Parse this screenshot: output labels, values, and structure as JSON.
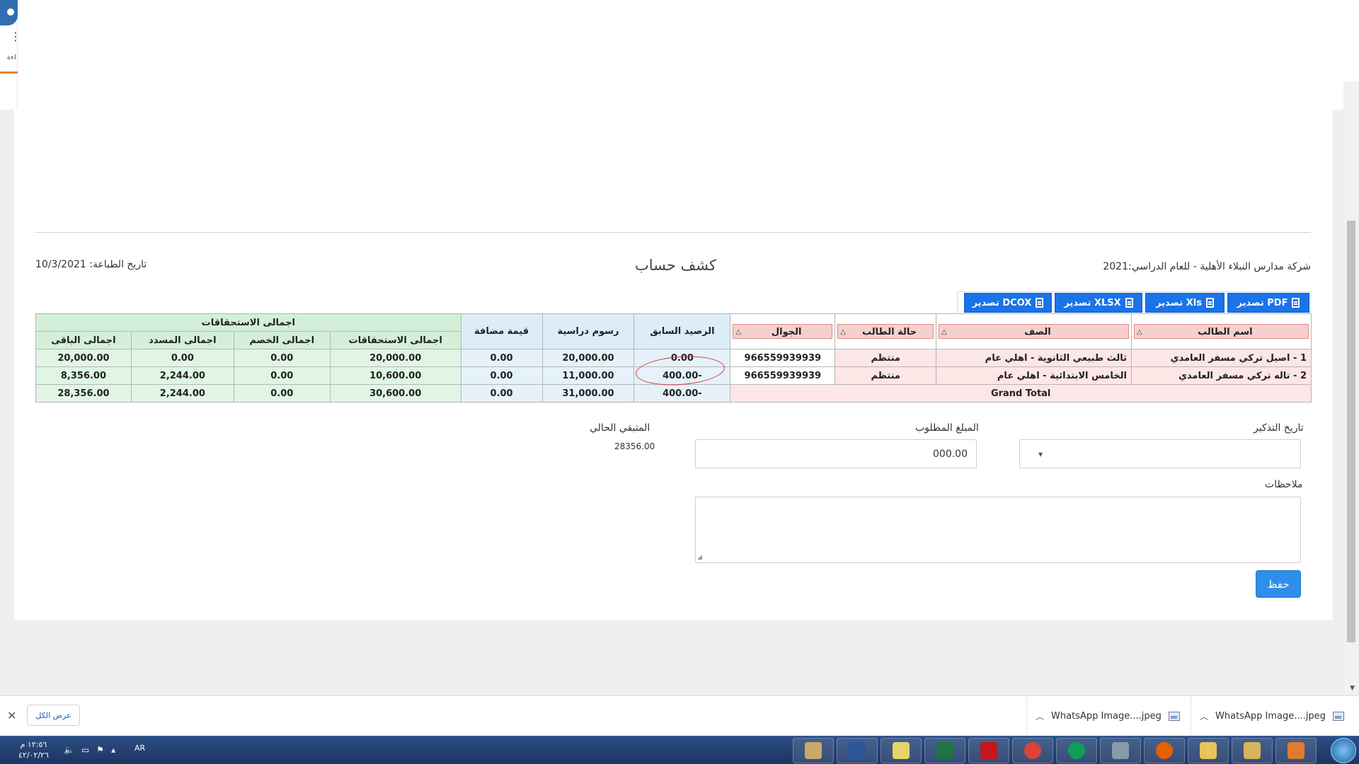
{
  "browser": {
    "menu_glyph": "⋮",
    "side_label": "اءة"
  },
  "report": {
    "company": "شركة مدارس النبلاء الأهلية  - للعام الدراسي:2021",
    "title": "كشف حساب",
    "print_date": "تاريخ الطباعة: 10/3/2021"
  },
  "export_buttons": [
    {
      "label": "تصدير PDF"
    },
    {
      "label": "تصدير Xls"
    },
    {
      "label": "تصدير XLSX"
    },
    {
      "label": "تصدير DCOX"
    }
  ],
  "table": {
    "headers": {
      "student_name": "اسم الطالب",
      "grade": "الصف",
      "status": "حالة الطالب",
      "mobile": "الجوال",
      "prev_balance": "الرصيد السابق",
      "tuition": "رسوم دراسية",
      "added_value": "قيمة مضافة",
      "dues_group": "اجمالى الاستحقاقات",
      "total_dues": "اجمالى الاستحقاقات",
      "total_discount": "اجمالى الخصم",
      "total_paid": "اجمالى المسدد",
      "total_remaining": "اجمالى الباقى",
      "sort_glyph": "△"
    },
    "rows": [
      {
        "name": "1 - اصيل تركي مسفر العامدي",
        "grade": "ثالث طبيعي الثانوية - اهلي عام",
        "status": "منتظم",
        "mobile": "966559939939",
        "prev_balance": "0.00",
        "tuition": "20,000.00",
        "added_value": "0.00",
        "total_dues": "20,000.00",
        "total_discount": "0.00",
        "total_paid": "0.00",
        "total_remaining": "20,000.00"
      },
      {
        "name": "2 - تاله تركي مسفر العامدي",
        "grade": "الخامس الابتدائية - اهلي عام",
        "status": "منتظم",
        "mobile": "966559939939",
        "prev_balance": "-400.00",
        "tuition": "11,000.00",
        "added_value": "0.00",
        "total_dues": "10,600.00",
        "total_discount": "0.00",
        "total_paid": "2,244.00",
        "total_remaining": "8,356.00"
      }
    ],
    "grand_total": {
      "label": "Grand Total",
      "prev_balance": "-400.00",
      "tuition": "31,000.00",
      "added_value": "0.00",
      "total_dues": "30,600.00",
      "total_discount": "0.00",
      "total_paid": "2,244.00",
      "total_remaining": "28,356.00"
    }
  },
  "form": {
    "reminder_date_label": "تاريخ التذكير",
    "required_amount_label": "المبلغ المطلوب",
    "required_amount_value": "000.00",
    "remaining_label": "المتبقي الحالي",
    "remaining_value": "28356.00",
    "notes_label": "ملاحظات",
    "save_label": "حفظ"
  },
  "downloads": {
    "show_all": "عرض الكل",
    "items": [
      {
        "name": "WhatsApp Image....jpeg"
      },
      {
        "name": "WhatsApp Image....jpeg"
      }
    ]
  },
  "taskbar": {
    "time": "١٢:٥٦ م",
    "date": "٤٢/٠٢/٢٦",
    "lang": "AR"
  },
  "colors": {
    "accent": "#1a73e8",
    "header_red": "#f6cfcf",
    "header_blue": "#dcedf7",
    "header_green": "#d4efd9",
    "annotation_red": "#d23a3a"
  }
}
